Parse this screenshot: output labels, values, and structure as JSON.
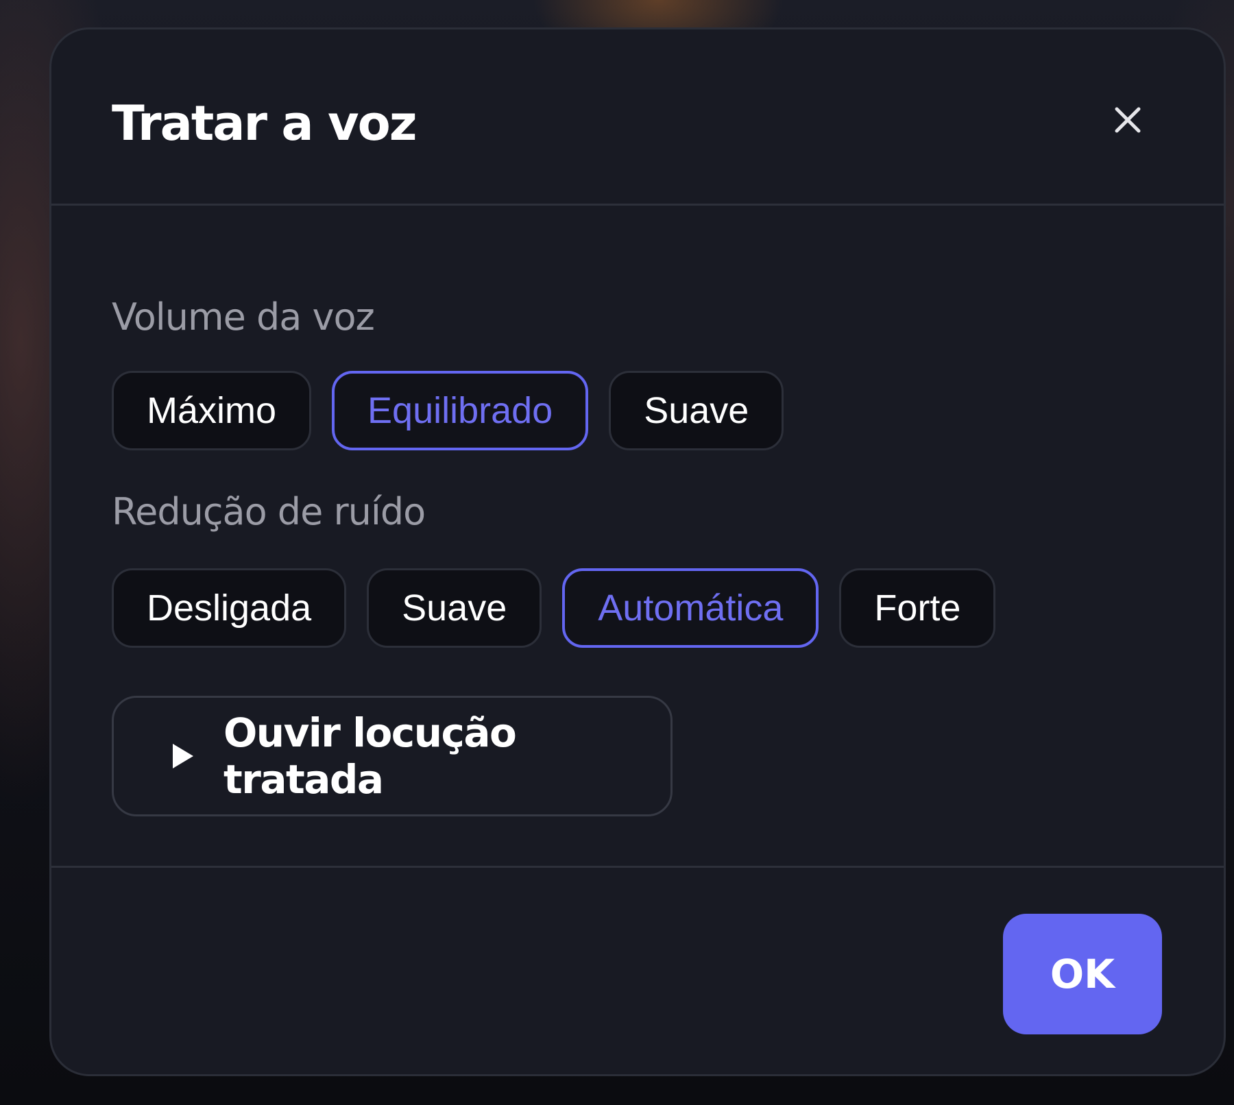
{
  "dialog": {
    "title": "Tratar a voz",
    "close_icon": "close-icon"
  },
  "volume": {
    "label": "Volume da voz",
    "options": [
      "Máximo",
      "Equilibrado",
      "Suave"
    ],
    "selected": "Equilibrado"
  },
  "noise": {
    "label": "Redução de ruído",
    "options": [
      "Desligada",
      "Suave",
      "Automática",
      "Forte"
    ],
    "selected": "Automática"
  },
  "preview": {
    "icon": "play-icon",
    "label": "Ouvir locução tratada"
  },
  "footer": {
    "ok_label": "OK"
  },
  "colors": {
    "accent": "#6366f1",
    "dialog_bg": "#181a23",
    "chip_bg": "#0e0f15",
    "muted_text": "#9b9ca6"
  }
}
